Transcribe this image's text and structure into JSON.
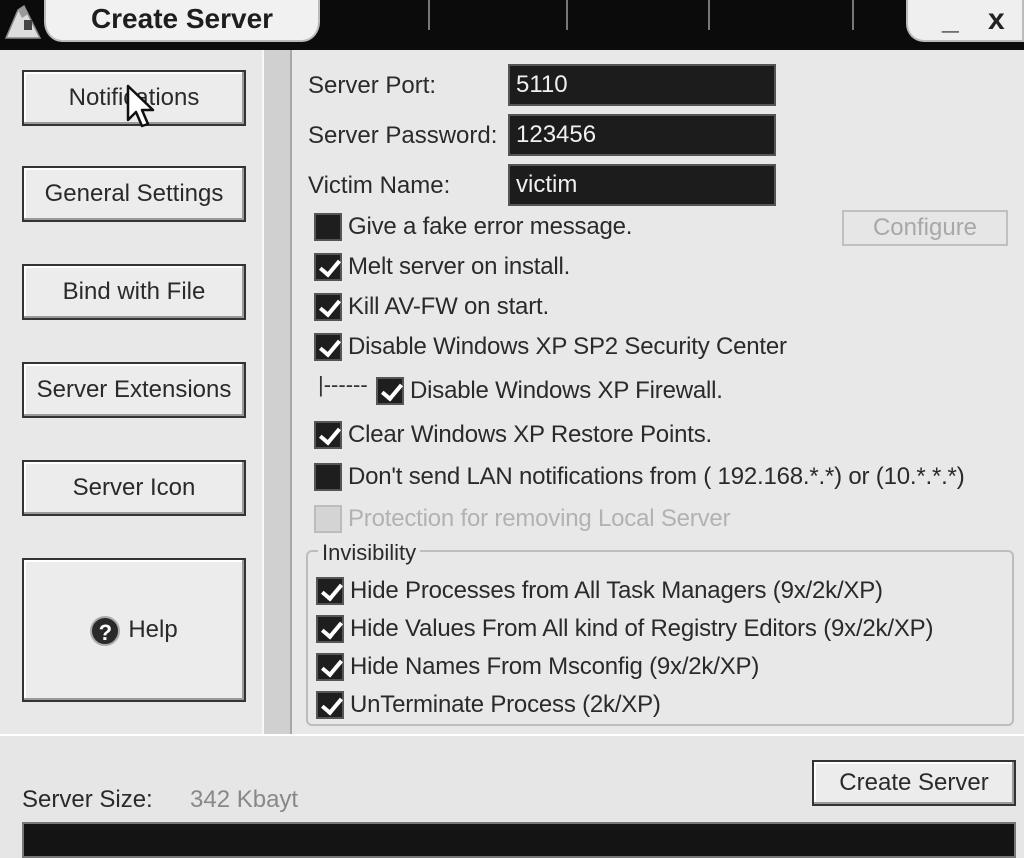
{
  "window": {
    "title": "Create Server",
    "minimize_label": "_",
    "close_label": "x"
  },
  "sidebar": {
    "items": [
      {
        "label": "Notifications"
      },
      {
        "label": "General Settings"
      },
      {
        "label": "Bind with File"
      },
      {
        "label": "Server Extensions"
      },
      {
        "label": "Server Icon"
      },
      {
        "label": "Help",
        "icon": "help-icon",
        "icon_glyph": "?"
      }
    ]
  },
  "fields": {
    "port_label": "Server Port:",
    "port_value": "5110",
    "password_label": "Server Password:",
    "password_value": "123456",
    "victim_label": "Victim Name:",
    "victim_value": "victim"
  },
  "configure_label": "Configure",
  "options": [
    {
      "label": "Give a fake error message.",
      "checked": false
    },
    {
      "label": "Melt server on install.",
      "checked": true
    },
    {
      "label": "Kill AV-FW on start.",
      "checked": true
    },
    {
      "label": "Disable Windows XP SP2 Security Center",
      "checked": true
    },
    {
      "label": "Disable Windows XP Firewall.",
      "checked": true
    },
    {
      "label": "Clear Windows XP Restore Points.",
      "checked": true
    },
    {
      "label": "Don't send LAN notifications from ( 192.168.*.*) or (10.*.*.*)",
      "checked": false
    },
    {
      "label": "Protection for removing Local Server",
      "checked": false,
      "disabled": true
    }
  ],
  "tree_connector": "|------",
  "invisibility": {
    "title": "Invisibility",
    "items": [
      {
        "label": "Hide Processes from All Task Managers  (9x/2k/XP)",
        "checked": true
      },
      {
        "label": "Hide Values From All kind of Registry Editors (9x/2k/XP)",
        "checked": true
      },
      {
        "label": "Hide Names From Msconfig  (9x/2k/XP)",
        "checked": true
      },
      {
        "label": "UnTerminate Process (2k/XP)",
        "checked": true
      }
    ]
  },
  "footer": {
    "server_size_label": "Server Size:",
    "server_size_value": "342 Kbayt",
    "create_label": "Create Server",
    "progress": 0
  }
}
